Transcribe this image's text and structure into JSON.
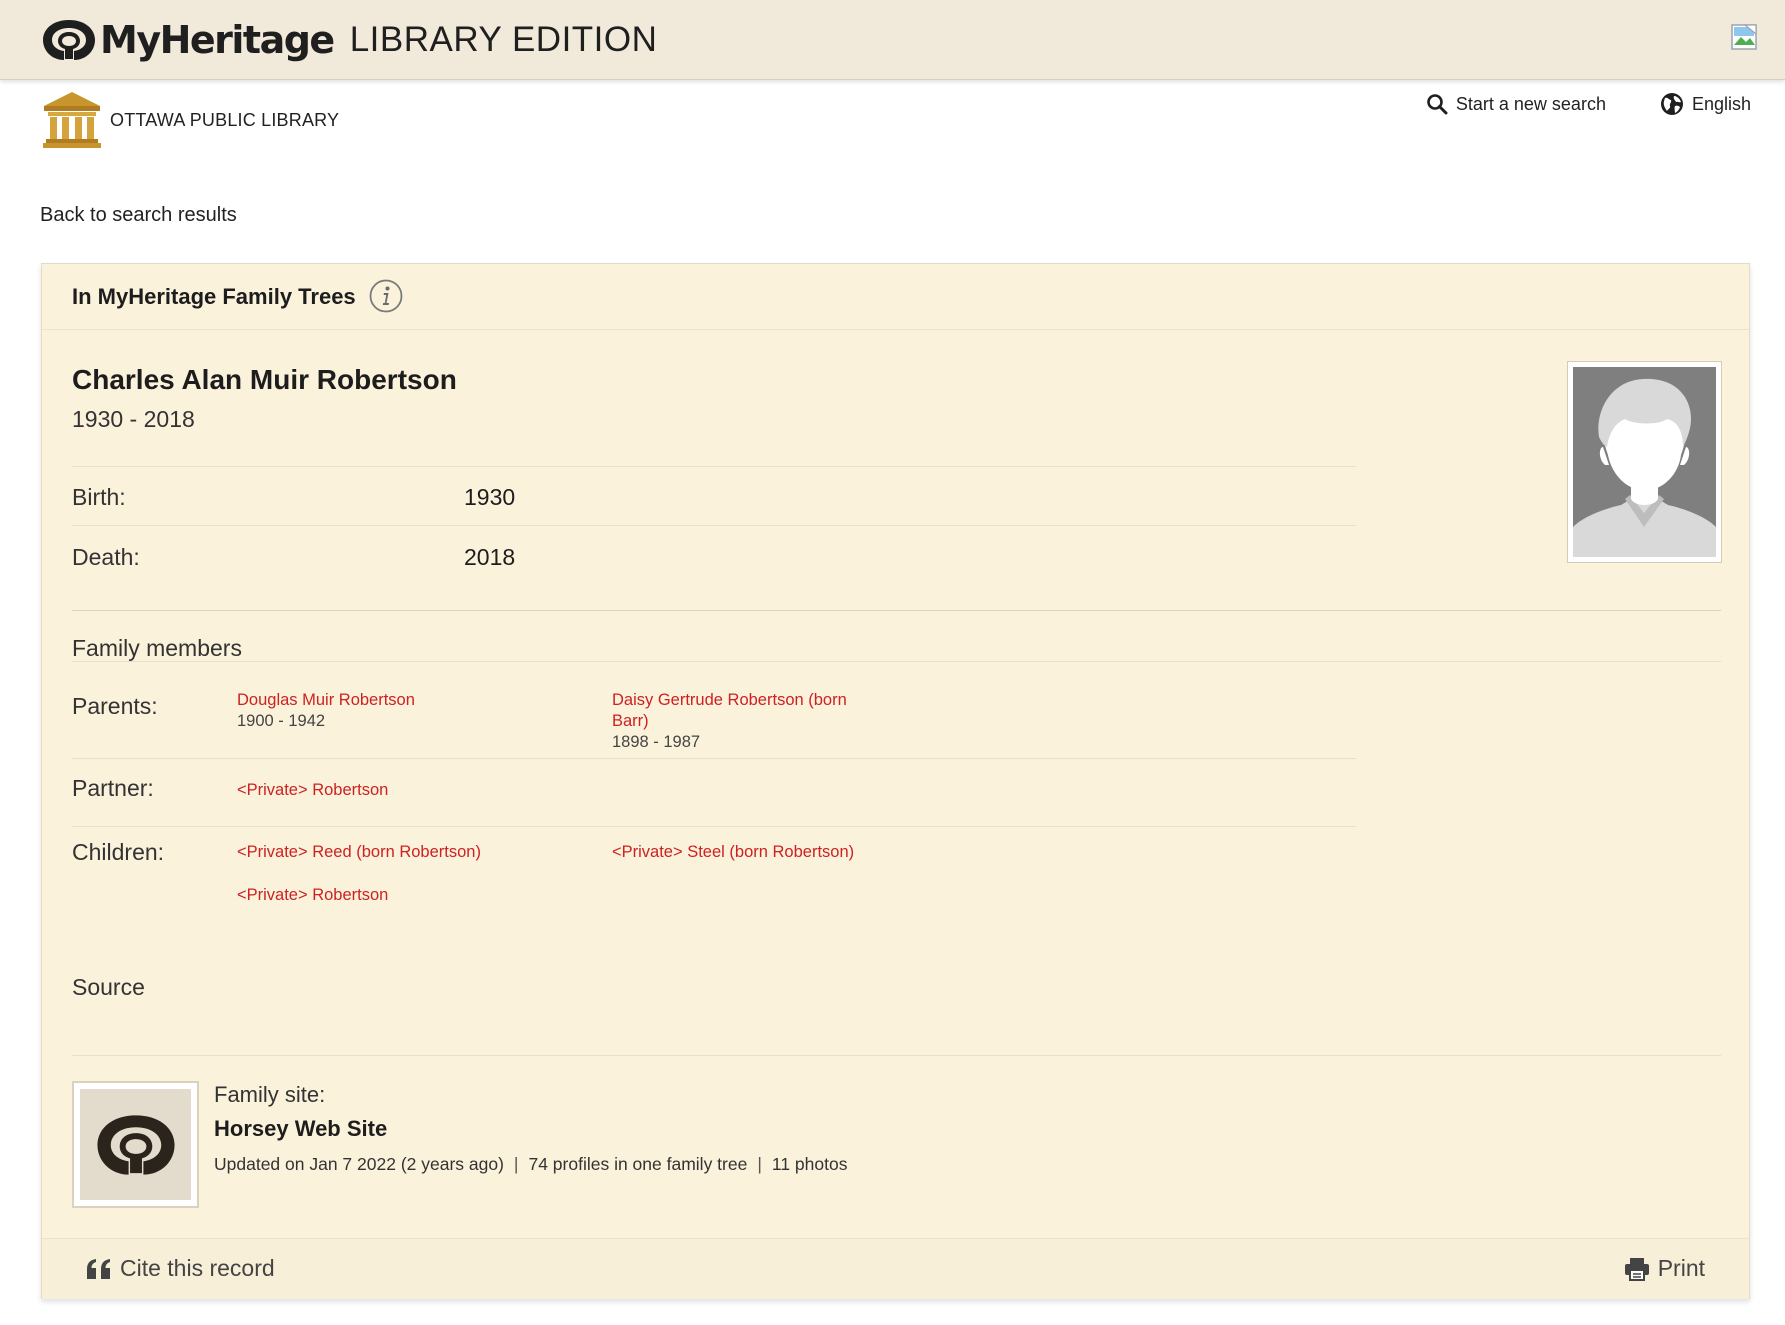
{
  "header": {
    "brand": "MyHeritage",
    "edition": "LIBRARY EDITION"
  },
  "library": {
    "name": "OTTAWA PUBLIC LIBRARY"
  },
  "top_links": {
    "search": "Start a new search",
    "language": "English"
  },
  "back_link": "Back to search results",
  "card": {
    "title": "In MyHeritage Family Trees",
    "person": {
      "name": "Charles Alan Muir Robertson",
      "years": "1930 - 2018"
    },
    "facts": [
      {
        "label": "Birth:",
        "value": "1930"
      },
      {
        "label": "Death:",
        "value": "2018"
      }
    ],
    "family_title": "Family members",
    "parents_label": "Parents:",
    "parents": [
      {
        "name": "Douglas Muir Robertson",
        "years": "1900 - 1942"
      },
      {
        "name": "Daisy Gertrude Robertson (born Barr)",
        "years": "1898 - 1987"
      }
    ],
    "partner_label": "Partner:",
    "partner": {
      "name": "<Private> Robertson"
    },
    "children_label": "Children:",
    "children": [
      {
        "name": "<Private> Reed (born Robertson)"
      },
      {
        "name": "<Private> Steel (born Robertson)"
      },
      {
        "name": "<Private> Robertson"
      }
    ],
    "source_title": "Source",
    "source": {
      "label": "Family site:",
      "site_name": "Horsey Web Site",
      "updated": "Updated on Jan 7 2022 (2 years ago)",
      "profiles": "74 profiles in one family tree",
      "photos": "11 photos",
      "separator": "|"
    },
    "footer": {
      "cite": "Cite this record",
      "print": "Print"
    }
  }
}
